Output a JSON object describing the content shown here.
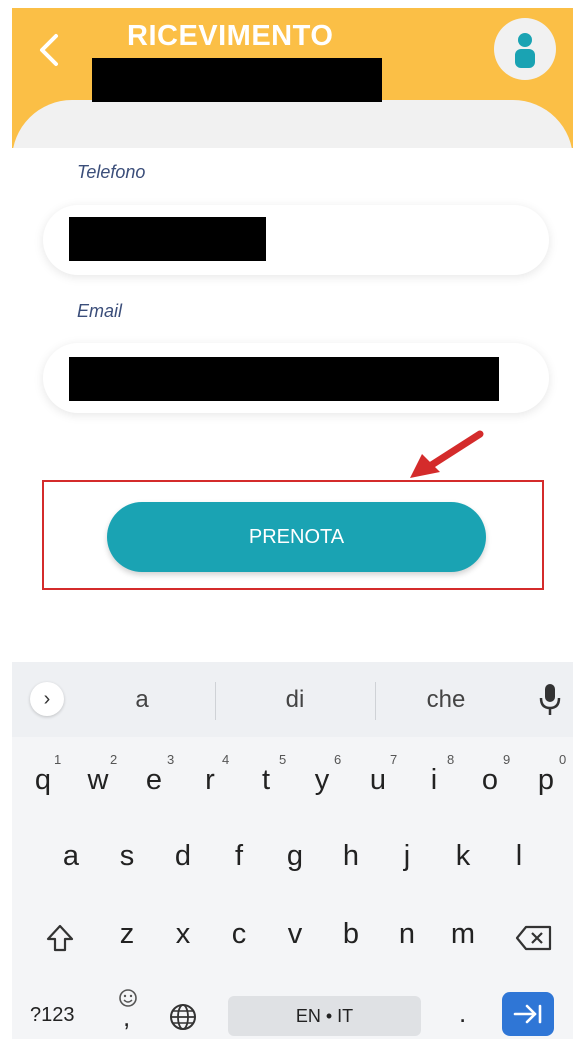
{
  "header": {
    "title": "RICEVIMENTO",
    "color": "#fbbf46"
  },
  "form": {
    "phone_label": "Telefono",
    "email_label": "Email"
  },
  "submit": {
    "label": "PRENOTA",
    "color": "#1aa3b3"
  },
  "annotation": {
    "highlight_color": "#d42b2b"
  },
  "keyboard": {
    "suggestions": [
      "a",
      "di",
      "che"
    ],
    "row1": [
      {
        "key": "q",
        "hint": "1"
      },
      {
        "key": "w",
        "hint": "2"
      },
      {
        "key": "e",
        "hint": "3"
      },
      {
        "key": "r",
        "hint": "4"
      },
      {
        "key": "t",
        "hint": "5"
      },
      {
        "key": "y",
        "hint": "6"
      },
      {
        "key": "u",
        "hint": "7"
      },
      {
        "key": "i",
        "hint": "8"
      },
      {
        "key": "o",
        "hint": "9"
      },
      {
        "key": "p",
        "hint": "0"
      }
    ],
    "row2": [
      "a",
      "s",
      "d",
      "f",
      "g",
      "h",
      "j",
      "k",
      "l"
    ],
    "row3": [
      "z",
      "x",
      "c",
      "v",
      "b",
      "n",
      "m"
    ],
    "symbols_label": "?123",
    "comma_label": ",",
    "space_label": "EN • IT",
    "period_label": ".",
    "icons": {
      "expand": "chevron-right-icon",
      "mic": "microphone-icon",
      "shift": "shift-icon",
      "backspace": "backspace-icon",
      "emoji": "emoji-icon",
      "globe": "globe-icon",
      "enter": "next-arrow-icon"
    }
  }
}
